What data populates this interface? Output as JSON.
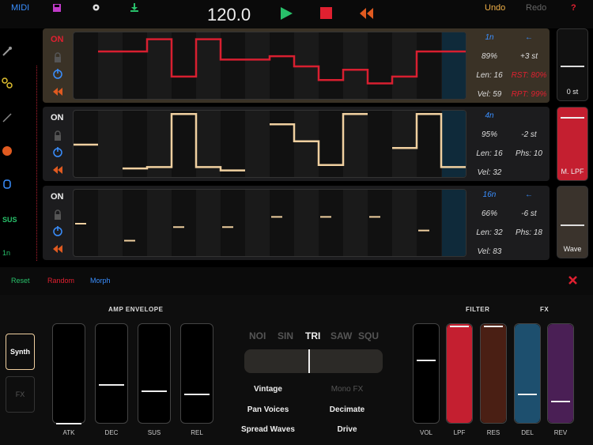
{
  "topbar": {
    "midi": "MIDI",
    "tempo": "120.0",
    "undo": "Undo",
    "redo": "Redo",
    "help": "?"
  },
  "left": {
    "sus": "SUS",
    "rate": "1n"
  },
  "sequencers": [
    {
      "on": "ON",
      "rate": "1n",
      "back": "←",
      "prob": "89%",
      "transpose": "+3 st",
      "len": "Len: 16",
      "extra": "RST: 80%",
      "vel": "Vel: 59",
      "rpt": "RPT: 99%",
      "steps": [
        null,
        0.72,
        0.72,
        0.9,
        0.35,
        0.9,
        0.6,
        0.6,
        0.65,
        0.5,
        0.3,
        0.45,
        0.25,
        0.35,
        0.72,
        0.72
      ]
    },
    {
      "on": "ON",
      "rate": "4n",
      "back": "",
      "prob": "95%",
      "transpose": "-2 st",
      "len": "Len: 16",
      "extra": "Phs: 10",
      "vel": "Vel: 32",
      "rpt": "",
      "steps": [
        0.5,
        null,
        0.15,
        0.17,
        0.95,
        0.17,
        0.12,
        null,
        0.8,
        0.55,
        0.2,
        0.95,
        null,
        0.45,
        0.95,
        0.17
      ]
    },
    {
      "on": "ON",
      "rate": "16n",
      "back": "←",
      "prob": "66%",
      "transpose": "-6 st",
      "len": "Len: 32",
      "extra": "Phs: 18",
      "vel": "Vel: 83",
      "rpt": "",
      "steps": [
        0.5,
        null,
        0.25,
        null,
        0.45,
        null,
        0.45,
        null,
        0.6,
        null,
        0.6,
        null,
        0.6,
        null,
        0.4,
        null
      ]
    }
  ],
  "right_sliders": [
    {
      "label": "0 st",
      "level": 0.5
    },
    {
      "label": "M. LPF",
      "level": 0.9
    },
    {
      "label": "Wave",
      "level": 0.4
    }
  ],
  "bottombar": {
    "reset": "Reset",
    "random": "Random",
    "morph": "Morph"
  },
  "panel": {
    "synth": "Synth",
    "fx": "FX",
    "amp_title": "AMP ENVELOPE",
    "filter_title": "FILTER",
    "fx_title": "FX",
    "env": [
      {
        "label": "ATK",
        "level": 0.0
      },
      {
        "label": "DEC",
        "level": 0.4
      },
      {
        "label": "SUS",
        "level": 0.33
      },
      {
        "label": "REL",
        "level": 0.3
      }
    ],
    "waves": [
      "NOI",
      "SIN",
      "TRI",
      "SAW",
      "SQU"
    ],
    "selected_wave": "TRI",
    "options": [
      [
        "Vintage",
        "Mono FX"
      ],
      [
        "Pan Voices",
        "Decimate"
      ],
      [
        "Spread Waves",
        "Drive"
      ]
    ],
    "right": [
      {
        "label": "VOL",
        "level": 0.65,
        "color": "#000000"
      },
      {
        "label": "LPF",
        "level": 1.0,
        "color": "#c41f30"
      },
      {
        "label": "RES",
        "level": 1.0,
        "color": "#4a1f14"
      },
      {
        "label": "DEL",
        "level": 0.3,
        "color": "#1d4f6e"
      },
      {
        "label": "REV",
        "level": 0.23,
        "color": "#4a1f55"
      }
    ]
  }
}
